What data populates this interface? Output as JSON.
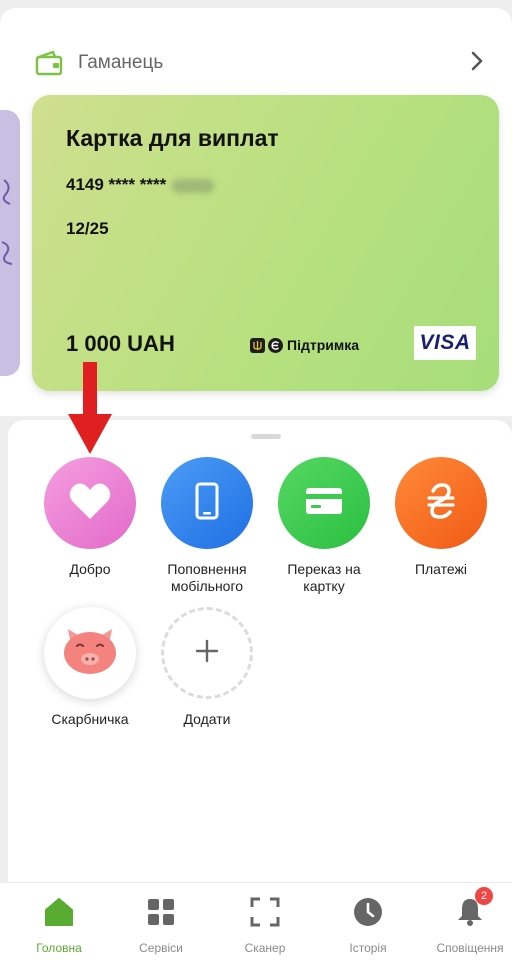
{
  "wallet": {
    "title": "Гаманець"
  },
  "card": {
    "title": "Картка для виплат",
    "number_masked": "4149 **** ****",
    "expiry": "12/25",
    "balance": "1 000 UAH",
    "support_label": "Підтримка",
    "network": "VISA",
    "gradient_colors": [
      "#cfdf8e",
      "#a6de7a"
    ]
  },
  "actions": [
    {
      "label": "Добро",
      "icon": "heart-icon",
      "color": "#e97ad0"
    },
    {
      "label": "Поповнення мобільного",
      "icon": "phone-icon",
      "color": "#2f82ee"
    },
    {
      "label": "Переказ на картку",
      "icon": "card-icon",
      "color": "#3bcb4e"
    },
    {
      "label": "Платежі",
      "icon": "hryvnia-icon",
      "color": "#f46a22"
    },
    {
      "label": "Скарбничка",
      "icon": "piggy-icon",
      "color": "#ffffff"
    },
    {
      "label": "Додати",
      "icon": "plus-icon",
      "color": "#ffffff"
    }
  ],
  "annotation": {
    "icon": "red-arrow-down",
    "color": "#e02020"
  },
  "tabs": [
    {
      "label": "Головна",
      "icon": "home-icon",
      "active": true
    },
    {
      "label": "Сервіси",
      "icon": "grid-icon"
    },
    {
      "label": "Сканер",
      "icon": "scan-icon"
    },
    {
      "label": "Історія",
      "icon": "clock-icon"
    },
    {
      "label": "Сповіщення",
      "icon": "bell-icon",
      "badge": "2"
    }
  ],
  "colors": {
    "accent": "#5aab32",
    "badge": "#f04545"
  }
}
